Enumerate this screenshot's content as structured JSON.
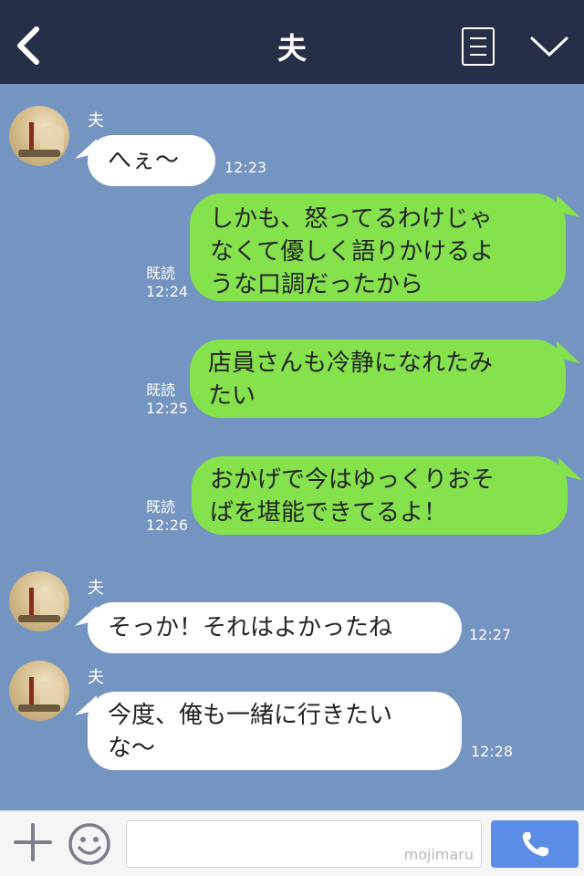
{
  "header": {
    "title": "夫"
  },
  "messages": [
    {
      "sender": "夫",
      "text": "へぇ〜",
      "time": "12:23"
    },
    {
      "text": "しかも、怒ってるわけじゃなくて優しく語りかけるような口調だったから",
      "lines": [
        "しかも、怒ってるわけじゃ",
        "なくて優しく語りかけるよ",
        "うな口調だったから"
      ],
      "read": "既読",
      "time": "12:24"
    },
    {
      "text": "店員さんも冷静になれたみたい",
      "lines": [
        "店員さんも冷静になれたみ",
        "たい"
      ],
      "read": "既読",
      "time": "12:25"
    },
    {
      "text": "おかげで今はゆっくりおそばを堪能できてるよ！",
      "lines": [
        "おかげで今はゆっくりおそ",
        "ばを堪能できてるよ！"
      ],
      "read": "既読",
      "time": "12:26"
    },
    {
      "sender": "夫",
      "text": "そっか！それはよかったね",
      "time": "12:27"
    },
    {
      "sender": "夫",
      "text": "今度、俺も一緒に行きたいな〜",
      "lines": [
        "今度、俺も一緒に行きたい",
        "な〜"
      ],
      "time": "12:28"
    }
  ],
  "input": {
    "watermark": "mojimaru"
  },
  "icons": {
    "back": "chevron-left-icon",
    "menu": "list-icon",
    "collapse": "chevron-down-icon",
    "add": "plus-icon",
    "emoji": "smile-icon",
    "call": "phone-icon"
  },
  "colors": {
    "header_bg": "#262f48",
    "chat_bg": "#7494c1",
    "outgoing_bubble": "#86e24c",
    "incoming_bubble": "#ffffff",
    "send_button": "#5b8ce6"
  }
}
